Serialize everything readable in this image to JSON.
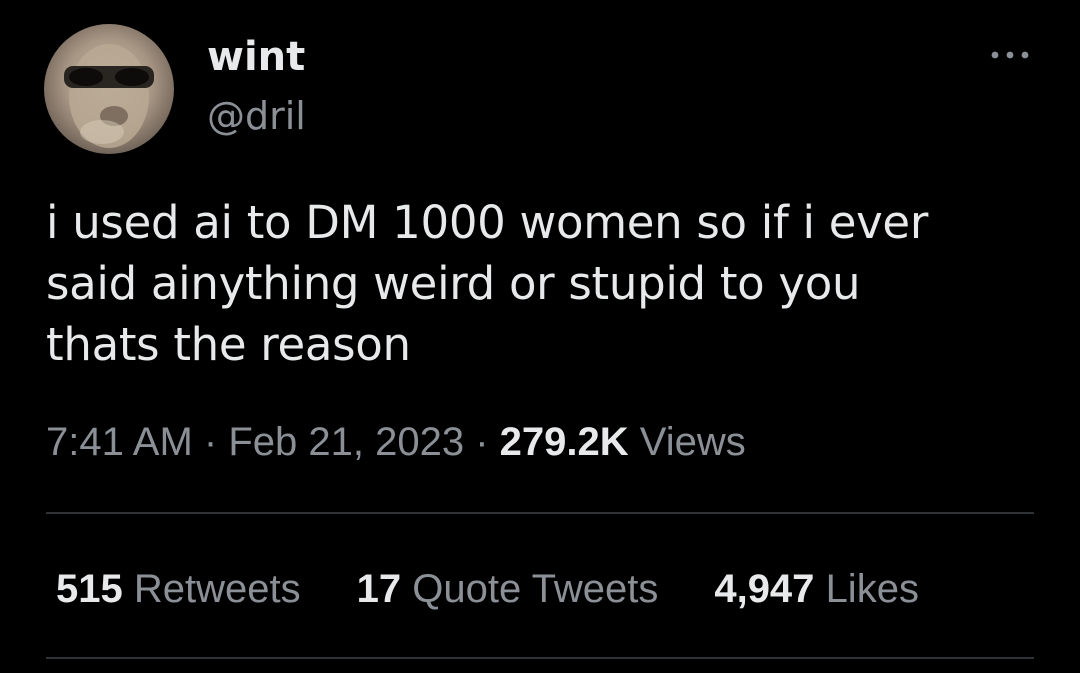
{
  "author": {
    "name": "wint",
    "handle": "@dril"
  },
  "tweet": {
    "text_lines": [
      "i used ai to DM 1000 women so if i ever",
      "said ainything weird or stupid to you",
      "thats the reason"
    ],
    "time": "7:41 AM",
    "separator": "·",
    "date": "Feb 21, 2023",
    "views_count": "279.2K",
    "views_label": "Views"
  },
  "stats": {
    "retweets_count": "515",
    "retweets_label": "Retweets",
    "quotes_count": "17",
    "quotes_label": "Quote Tweets",
    "likes_count": "4,947",
    "likes_label": "Likes"
  },
  "icons": {
    "more": "more-horizontal-icon"
  },
  "colors": {
    "background": "#000000",
    "primary_text": "#e7e9ea",
    "secondary_text": "#8b9097",
    "divider": "#2f3336"
  }
}
